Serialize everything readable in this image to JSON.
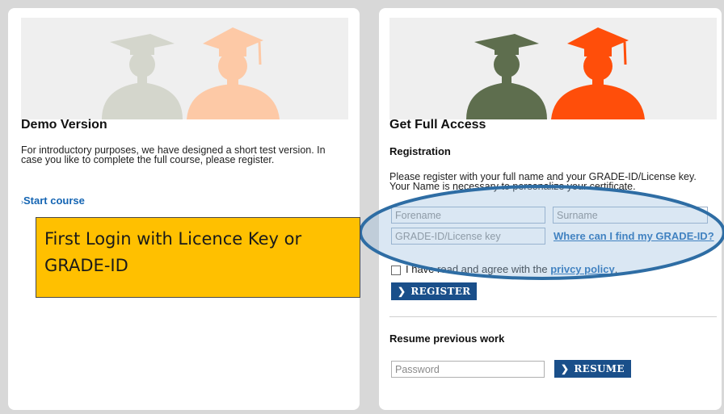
{
  "demo": {
    "title": "Demo Version",
    "description": "For introductory purposes, we have designed a short test version. In case you like to complete the full course, please register.",
    "start_link": "Start course"
  },
  "full": {
    "title": "Get Full Access",
    "registration_heading": "Registration",
    "registration_text": "Please register with your full name and your GRADE-ID/License key. Your Name is necessary to personalize your certificate.",
    "forename_placeholder": "Forename",
    "surname_placeholder": "Surname",
    "license_placeholder": "GRADE-ID/License key",
    "find_link": "Where can I find my GRADE-ID?",
    "agree_text": "I have read and agree with the ",
    "privacy_link": "privcy policy",
    "register_label": "REGISTER",
    "resume_heading": "Resume previous work",
    "password_placeholder": "Password",
    "resume_label": "RESUME"
  },
  "callout": {
    "text": "First Login with Licence Key or GRADE-ID"
  },
  "colors": {
    "accent_blue": "#1a4f8a",
    "link_blue": "#1565b3",
    "callout_yellow": "#ffc000",
    "ellipse_blue": "#2e6da4",
    "figure_green": "#5e6e4e",
    "figure_orange": "#ff4e0a"
  },
  "icons": {
    "chevron": "chevron-right-icon",
    "banner_figures": "graduate-silhouettes-illustration"
  }
}
